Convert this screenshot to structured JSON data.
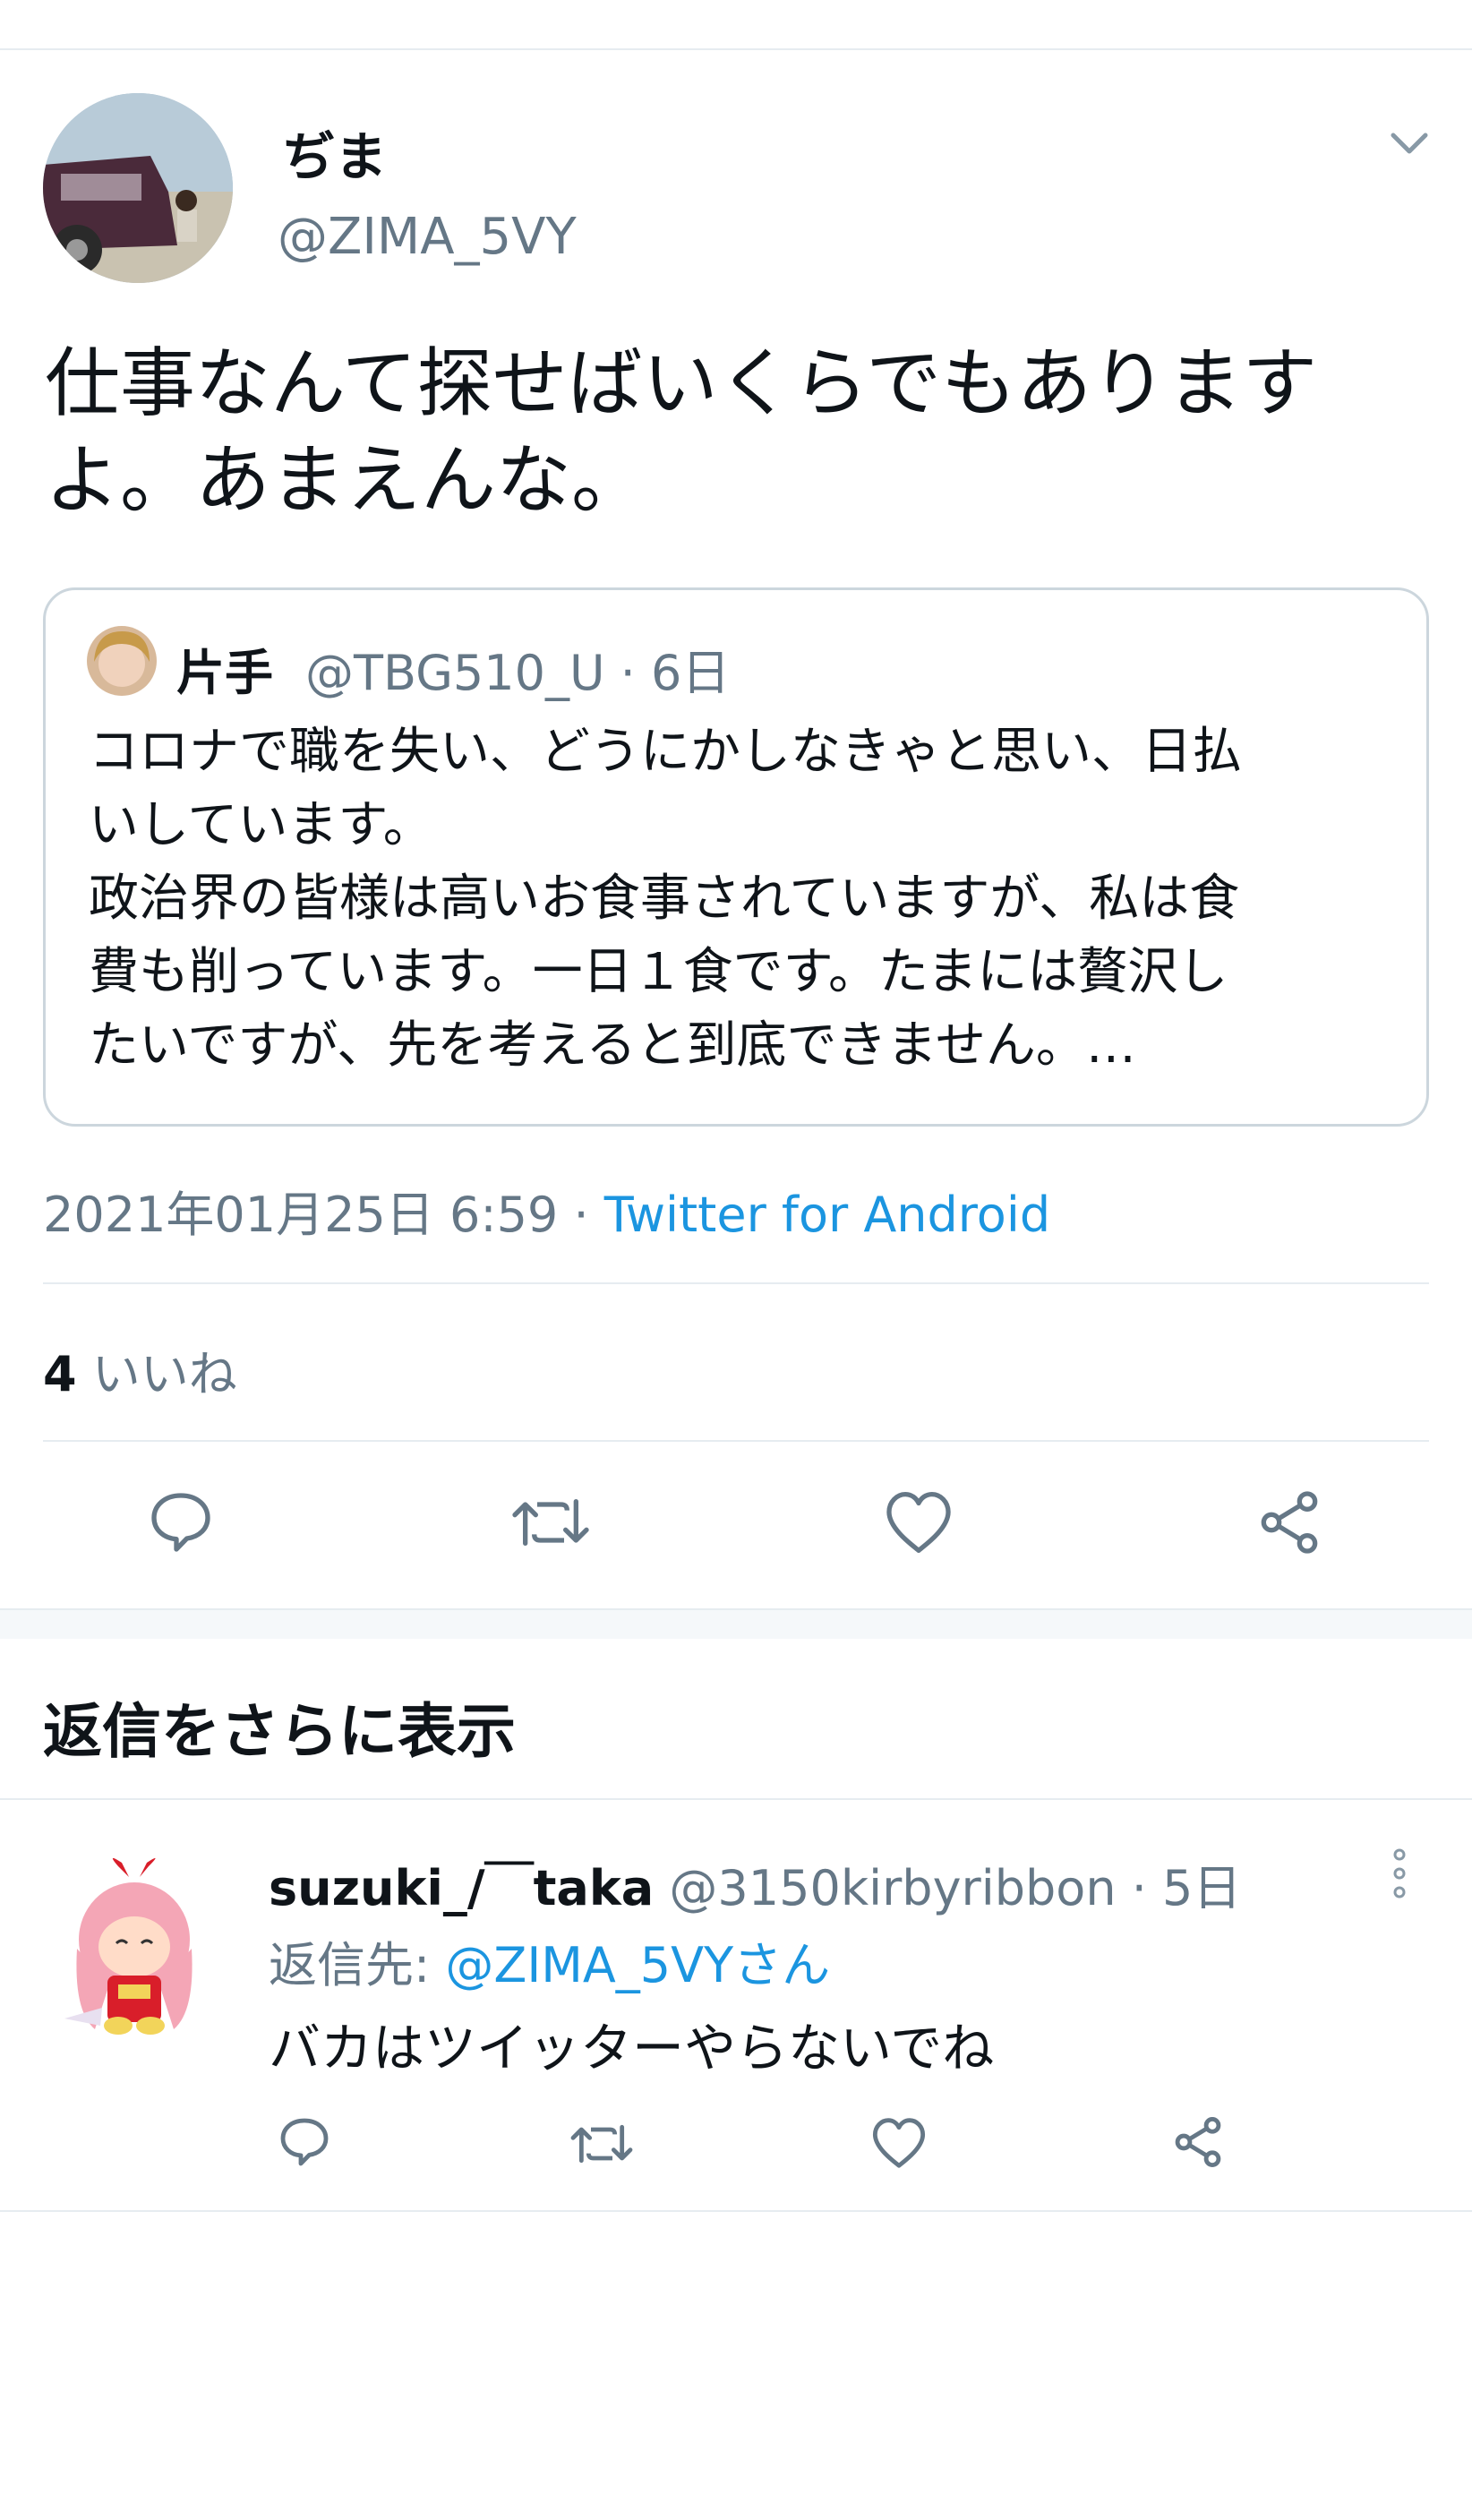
{
  "colors": {
    "accent": "#1b95e0",
    "secondary_text": "#657786",
    "divider": "#e6ecf0",
    "section_bg": "#f5f8fa"
  },
  "main_tweet": {
    "author_name": "ぢま",
    "author_handle": "@ZIMA_5VY",
    "text_line1": "仕事なんて探せばいくらでもありますよ。あまえんな。",
    "quote": {
      "name": "片手",
      "handle_time": "@TBG510_U · 6日",
      "lines": [
        "コロナで職を失い、どうにかしなきゃと思い、日払",
        "いしています。",
        "政治界の皆様は高いお食事されていますが、私は食",
        "費も削っています。一日１食です。たまには贅沢し",
        "たいですが、先を考えると到底できません。…"
      ]
    },
    "timestamp": "2021年01月25日 6:59",
    "separator": " · ",
    "source": "Twitter for Android",
    "likes_count": "4",
    "likes_label": "いいね",
    "icons": [
      "reply-icon",
      "retweet-icon",
      "like-icon",
      "share-icon"
    ]
  },
  "more_replies_label": "返信をさらに表示",
  "reply": {
    "name": "suzuki_/￣taka",
    "handle_time": "@3150kirbyribbon · 5日",
    "replying_prefix": "返信先: ",
    "replying_to": "@ZIMA_5VYさん",
    "text": "バカはツイッターやらないでね"
  }
}
